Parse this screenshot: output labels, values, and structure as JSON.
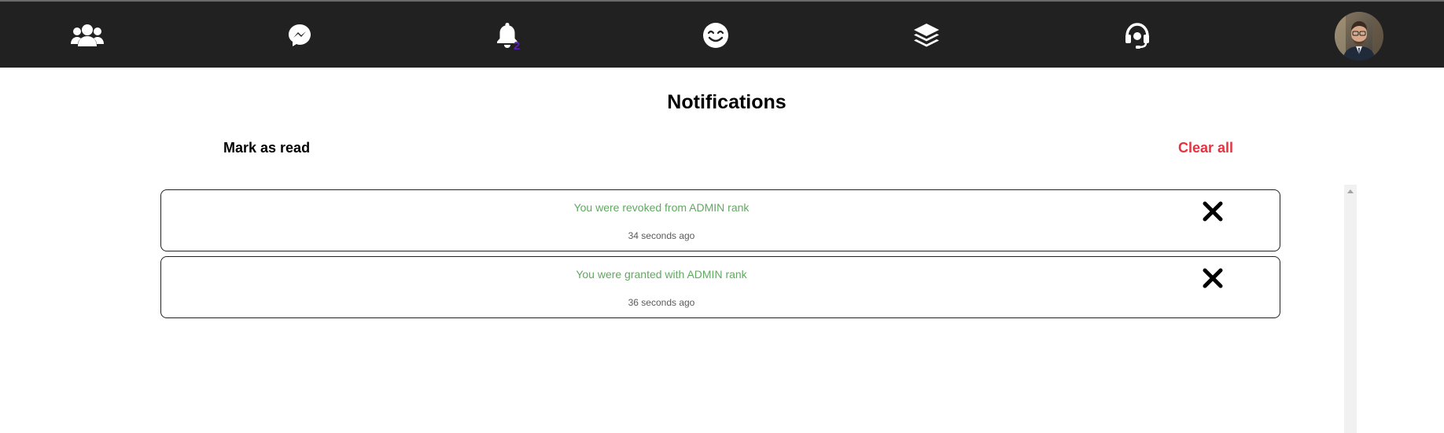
{
  "nav": {
    "items": [
      {
        "icon": "users-icon"
      },
      {
        "icon": "messenger-icon"
      },
      {
        "icon": "bell-icon",
        "badge": "2"
      },
      {
        "icon": "smile-icon"
      },
      {
        "icon": "layers-icon"
      },
      {
        "icon": "headset-icon"
      }
    ],
    "avatar": "user-avatar"
  },
  "page": {
    "title": "Notifications",
    "mark_as_read": "Mark as read",
    "clear_all": "Clear all"
  },
  "notifications": [
    {
      "message": "You were revoked from ADMIN rank",
      "time": "34 seconds ago"
    },
    {
      "message": "You were granted with ADMIN rank",
      "time": "36 seconds ago"
    }
  ],
  "colors": {
    "topbar_bg": "#212121",
    "badge": "#5b1fb5",
    "clear_all": "#e53340",
    "message_text": "#5faa5f",
    "time_text": "#5a5a5a"
  }
}
